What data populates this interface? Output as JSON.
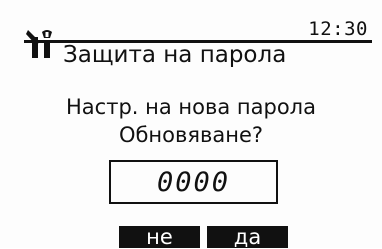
{
  "header": {
    "time": "12:30",
    "title": "Защита на парола",
    "icon": "wrench-screwdriver-icon"
  },
  "dialog": {
    "line1": "Настр. на нова парола",
    "line2": "Обновяване?",
    "pin_value": "0000"
  },
  "softkeys": {
    "no_label": "не",
    "yes_label": "да"
  }
}
